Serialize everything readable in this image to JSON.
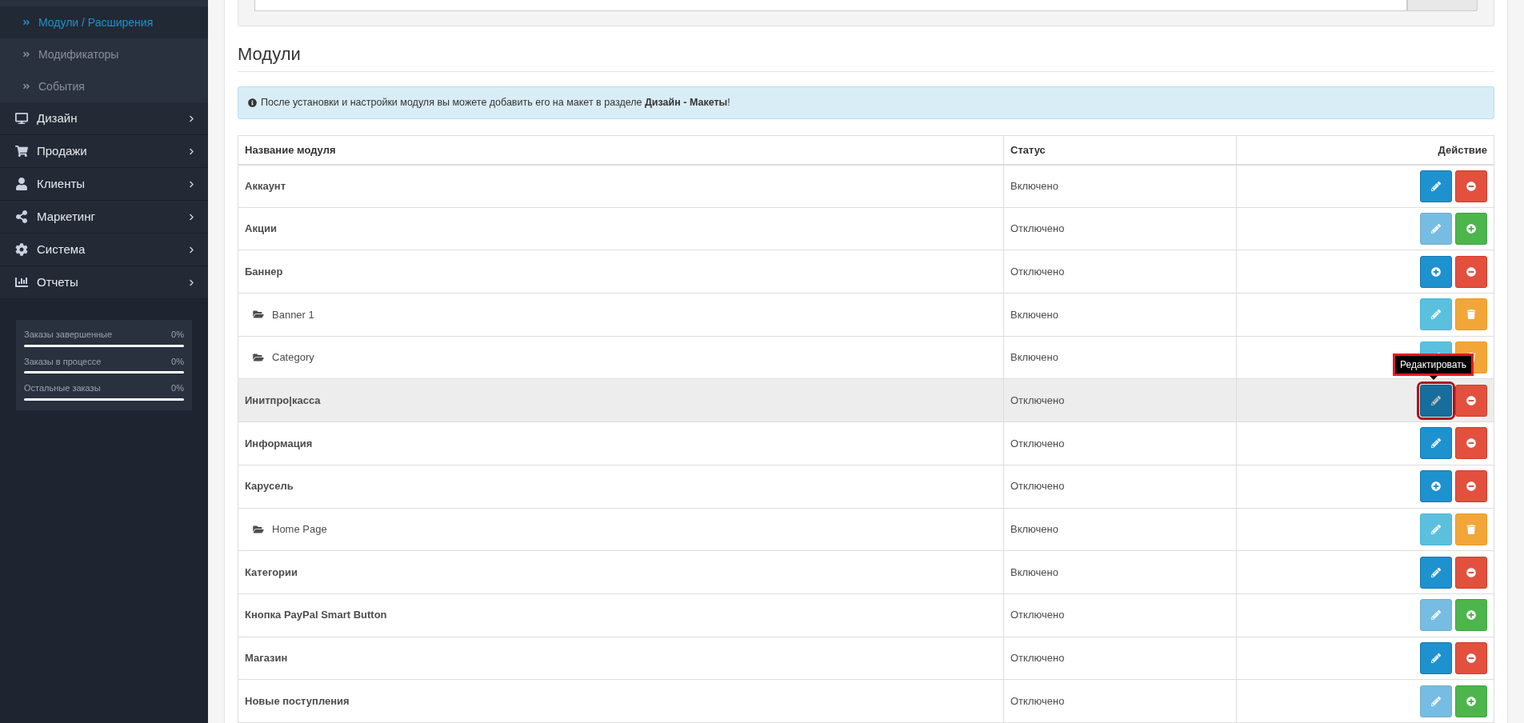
{
  "sidebar": {
    "subitems": [
      {
        "label": "Модули / Расширения",
        "selected": true
      },
      {
        "label": "Модификаторы",
        "selected": false
      },
      {
        "label": "События",
        "selected": false
      }
    ],
    "menu": [
      {
        "label": "Дизайн"
      },
      {
        "label": "Продажи"
      },
      {
        "label": "Клиенты"
      },
      {
        "label": "Маркетинг"
      },
      {
        "label": "Система"
      },
      {
        "label": "Отчеты"
      }
    ],
    "stats": [
      {
        "label": "Заказы завершенные",
        "reading": "0%",
        "level": 0
      },
      {
        "label": "Заказы в процессе",
        "reading": "0%",
        "level": 0
      },
      {
        "label": "Остальные заказы",
        "reading": "0%",
        "level": 0
      }
    ]
  },
  "heading": "Модули",
  "alert": "После установки и настройки модуля вы можете добавить его на макет в разделе **Дизайн - Макеты**!",
  "table": {
    "columns": [
      "Название модуля",
      "Статус",
      "Действие"
    ],
    "rows": [
      {
        "kind": "module",
        "name": "Аккаунт",
        "status": "Включено",
        "hovered": false,
        "actions": [
          {
            "kind": "edit",
            "disabled": false
          },
          {
            "kind": "uninstall",
            "disabled": false
          }
        ]
      },
      {
        "kind": "module",
        "name": "Акции",
        "status": "Отключено",
        "hovered": false,
        "actions": [
          {
            "kind": "edit",
            "disabled": true
          },
          {
            "kind": "install",
            "disabled": false
          }
        ]
      },
      {
        "kind": "module",
        "name": "Баннер",
        "status": "Отключено",
        "hovered": false,
        "actions": [
          {
            "kind": "add",
            "disabled": false
          },
          {
            "kind": "uninstall",
            "disabled": false
          }
        ]
      },
      {
        "kind": "instance",
        "name": "Banner 1",
        "status": "Включено",
        "hovered": false,
        "actions": [
          {
            "kind": "edit-instance",
            "disabled": false
          },
          {
            "kind": "delete",
            "disabled": false
          }
        ]
      },
      {
        "kind": "instance",
        "name": "Category",
        "status": "Включено",
        "hovered": false,
        "actions": [
          {
            "kind": "edit-instance",
            "disabled": false
          },
          {
            "kind": "delete",
            "disabled": false
          }
        ]
      },
      {
        "kind": "module",
        "name": "Инитпро|касса",
        "status": "Отключено",
        "hovered": true,
        "actions": [
          {
            "kind": "edit",
            "disabled": false,
            "highlighted": true,
            "tooltip": "Редактировать"
          },
          {
            "kind": "uninstall",
            "disabled": false
          }
        ]
      },
      {
        "kind": "module",
        "name": "Информация",
        "status": "Отключено",
        "hovered": false,
        "actions": [
          {
            "kind": "edit",
            "disabled": false
          },
          {
            "kind": "uninstall",
            "disabled": false
          }
        ]
      },
      {
        "kind": "module",
        "name": "Карусель",
        "status": "Отключено",
        "hovered": false,
        "actions": [
          {
            "kind": "add",
            "disabled": false
          },
          {
            "kind": "uninstall",
            "disabled": false
          }
        ]
      },
      {
        "kind": "instance",
        "name": "Home Page",
        "status": "Включено",
        "hovered": false,
        "actions": [
          {
            "kind": "edit-instance",
            "disabled": false
          },
          {
            "kind": "delete",
            "disabled": false
          }
        ]
      },
      {
        "kind": "module",
        "name": "Категории",
        "status": "Включено",
        "hovered": false,
        "actions": [
          {
            "kind": "edit",
            "disabled": false
          },
          {
            "kind": "uninstall",
            "disabled": false
          }
        ]
      },
      {
        "kind": "module",
        "name": "Кнопка PayPal Smart Button",
        "status": "Отключено",
        "hovered": false,
        "actions": [
          {
            "kind": "edit",
            "disabled": true
          },
          {
            "kind": "install",
            "disabled": false
          }
        ]
      },
      {
        "kind": "module",
        "name": "Магазин",
        "status": "Отключено",
        "hovered": false,
        "actions": [
          {
            "kind": "edit",
            "disabled": false
          },
          {
            "kind": "uninstall",
            "disabled": false
          }
        ]
      },
      {
        "kind": "module",
        "name": "Новые поступления",
        "status": "Отключено",
        "hovered": false,
        "actions": [
          {
            "kind": "edit",
            "disabled": true
          },
          {
            "kind": "install",
            "disabled": false
          }
        ]
      }
    ]
  }
}
